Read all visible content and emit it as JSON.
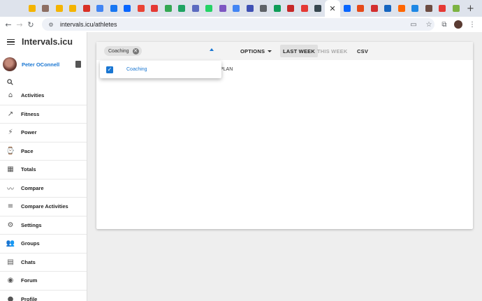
{
  "browser": {
    "tabs": [
      {
        "icon": "drive-icon",
        "color": "#f4b400"
      },
      {
        "icon": "person-icon",
        "color": "#8d6e63"
      },
      {
        "icon": "drive-icon",
        "color": "#f4b400"
      },
      {
        "icon": "drive-icon",
        "color": "#f4b400"
      },
      {
        "icon": "red-app-icon",
        "color": "#d93025"
      },
      {
        "icon": "google-icon",
        "color": "#4285f4"
      },
      {
        "icon": "facebook-icon",
        "color": "#1877f2"
      },
      {
        "icon": "meta-icon",
        "color": "#0866ff"
      },
      {
        "icon": "gmail-icon",
        "color": "#ea4335"
      },
      {
        "icon": "pulse-icon",
        "color": "#e53935"
      },
      {
        "icon": "calendar-icon",
        "color": "#34a853"
      },
      {
        "icon": "drive-icon",
        "color": "#1fa463"
      },
      {
        "icon": "purple-app-icon",
        "color": "#5c6bc0"
      },
      {
        "icon": "whatsapp-icon",
        "color": "#25d366"
      },
      {
        "icon": "s-app-icon",
        "color": "#7e57c2"
      },
      {
        "icon": "sparkle-icon",
        "color": "#4285f4"
      },
      {
        "icon": "gear-app-icon",
        "color": "#3f51b5"
      },
      {
        "icon": "globe-icon",
        "color": "#5f6368"
      },
      {
        "icon": "green-app-icon",
        "color": "#0f9d58"
      },
      {
        "icon": "red-app-icon",
        "color": "#c62828"
      },
      {
        "icon": "m-app-icon",
        "color": "#e53935"
      },
      {
        "icon": "intervals-icon",
        "color": "#37474f"
      }
    ],
    "active_tab": {
      "icon": "close-icon",
      "glyph": "✕"
    },
    "tabs_after": [
      {
        "icon": "meta-icon",
        "color": "#0866ff"
      },
      {
        "icon": "orange-app-icon",
        "color": "#e64a19"
      },
      {
        "icon": "red-app-icon",
        "color": "#d32f2f"
      },
      {
        "icon": "blue-app-icon",
        "color": "#1565c0"
      },
      {
        "icon": "yc-icon",
        "color": "#ff6600"
      },
      {
        "icon": "c-app-icon",
        "color": "#1e88e5"
      },
      {
        "icon": "chart-app-icon",
        "color": "#6d4c41"
      },
      {
        "icon": "pulse-icon",
        "color": "#e53935"
      },
      {
        "icon": "extension-icon",
        "color": "#7cb342"
      }
    ],
    "new_tab_glyph": "+",
    "url": "intervals.icu/athletes"
  },
  "app": {
    "title": "Intervals.icu",
    "user_name": "Peter OConnell",
    "nav": [
      {
        "key": "activities",
        "label": "Activities",
        "icon": "home-icon",
        "glyph": "⌂"
      },
      {
        "key": "fitness",
        "label": "Fitness",
        "icon": "trending-up-icon",
        "glyph": "↗"
      },
      {
        "key": "power",
        "label": "Power",
        "icon": "bolt-icon",
        "glyph": "⚡"
      },
      {
        "key": "pace",
        "label": "Pace",
        "icon": "watch-icon",
        "glyph": "⌚"
      },
      {
        "key": "totals",
        "label": "Totals",
        "icon": "calendar-icon",
        "glyph": "▦"
      },
      {
        "key": "compare",
        "label": "Compare",
        "icon": "compare-chart-icon",
        "glyph": "〰"
      },
      {
        "key": "compare-activities",
        "label": "Compare Activities",
        "icon": "list-search-icon",
        "glyph": "≡"
      },
      {
        "key": "settings",
        "label": "Settings",
        "icon": "gear-icon",
        "glyph": "⚙"
      },
      {
        "key": "groups",
        "label": "Groups",
        "icon": "group-icon",
        "glyph": "👥"
      },
      {
        "key": "chats",
        "label": "Chats",
        "icon": "chat-icon",
        "glyph": "▤"
      },
      {
        "key": "forum",
        "label": "Forum",
        "icon": "forum-icon",
        "glyph": "◉"
      },
      {
        "key": "profile",
        "label": "Profile",
        "icon": "profile-icon",
        "glyph": "●"
      }
    ]
  },
  "athletes": {
    "filter_chip": "Coaching",
    "chip_clear_glyph": "✕",
    "options_label": "OPTIONS",
    "last_week_label": "LAST WEEK",
    "this_week_label": "THIS WEEK",
    "csv_label": "CSV",
    "partial_text": "PLAN",
    "dropdown": {
      "items": [
        {
          "label": "Coaching",
          "checked": true
        }
      ],
      "check_glyph": "✓"
    }
  },
  "colors": {
    "accent": "#1976d2"
  }
}
